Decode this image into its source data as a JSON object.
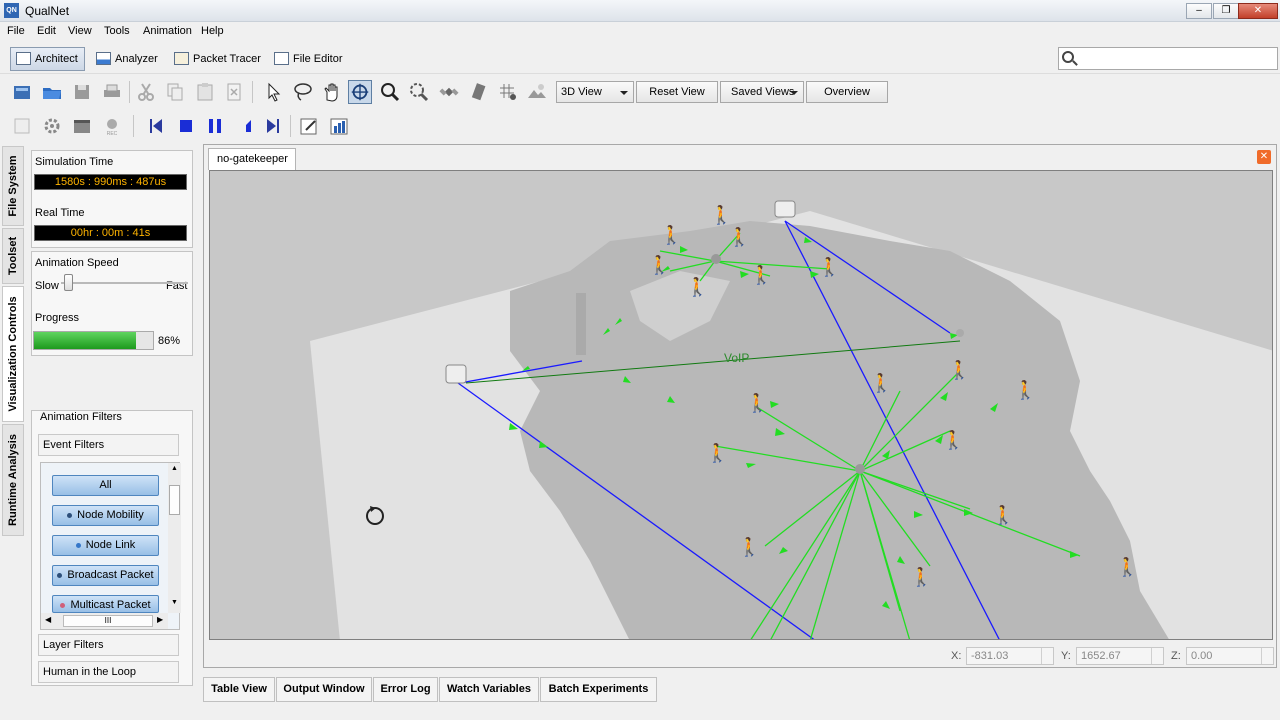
{
  "window": {
    "title": "QualNet",
    "app_icon": "QN"
  },
  "menu": [
    "File",
    "Edit",
    "View",
    "Tools",
    "Animation",
    "Help"
  ],
  "perspectives": [
    {
      "label": "Architect",
      "active": true
    },
    {
      "label": "Analyzer",
      "active": false
    },
    {
      "label": "Packet Tracer",
      "active": false
    },
    {
      "label": "File Editor",
      "active": false
    }
  ],
  "search": {
    "value": "",
    "placeholder": ""
  },
  "view_controls": {
    "view_mode": "3D View",
    "reset_view": "Reset View",
    "saved_views": "Saved Views",
    "overview": "Overview"
  },
  "side_tabs": [
    "File System",
    "Toolset",
    "Visualization Controls",
    "Runtime Analysis"
  ],
  "visualization": {
    "sim_time_label": "Simulation Time",
    "sim_time_value": "1580s : 990ms : 487us",
    "real_time_label": "Real Time",
    "real_time_value": "00hr : 00m : 41s",
    "speed_label": "Animation Speed",
    "slow": "Slow",
    "fast": "Fast",
    "speed_level": 0.02,
    "progress_label": "Progress",
    "progress_value": "86%",
    "progress_fraction": 0.86
  },
  "filters": {
    "animation_filters": "Animation Filters",
    "event_filters": "Event Filters",
    "buttons": [
      "All",
      "Node Mobility",
      "Node Link",
      "Broadcast Packet",
      "Multicast Packet"
    ],
    "layer_filters": "Layer Filters",
    "human_in_loop": "Human in the Loop",
    "scroll_thumb": "III"
  },
  "scenario": {
    "tab": "no-gatekeeper",
    "link_label": "VoIP"
  },
  "coords": {
    "x_label": "X:",
    "x_value": "-831.03",
    "y_label": "Y:",
    "y_value": "1652.67",
    "z_label": "Z:",
    "z_value": "0.00"
  },
  "bottom_tabs": [
    "Table View",
    "Output Window",
    "Error Log",
    "Watch Variables",
    "Batch Experiments"
  ],
  "colors": {
    "link_blue": "#1a1aff",
    "packet_green": "#22dd22",
    "progress_green": "#2bb52b"
  }
}
